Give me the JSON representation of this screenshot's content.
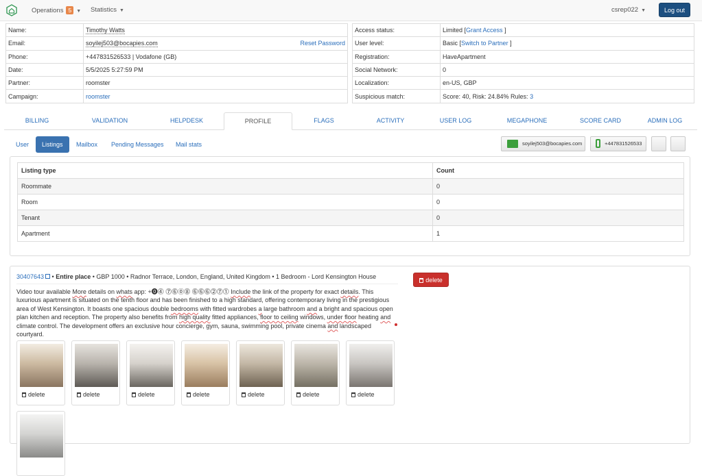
{
  "navbar": {
    "operations_label": "Operations",
    "operations_count": "5",
    "statistics_label": "Statistics",
    "username": "csrep022",
    "logout_label": "Log out"
  },
  "info_left": [
    {
      "label": "Name:",
      "value": "Timothy Watts"
    },
    {
      "label": "Email:",
      "value": "soyilej503@bocapies.com",
      "action": "Reset Password"
    },
    {
      "label": "Phone:",
      "value": "+447831526533 | Vodafone (GB)"
    },
    {
      "label": "Date:",
      "value": "5/5/2025 5:27:59 PM"
    },
    {
      "label": "Partner:",
      "value": "roomster"
    },
    {
      "label": "Campaign:",
      "value": "roomster"
    }
  ],
  "info_right": [
    {
      "label": "Access status:",
      "value": "Limited",
      "bracket_open": " [",
      "link": "Grant Access",
      "bracket_close": " ]"
    },
    {
      "label": "User level:",
      "value": "Basic",
      "bracket_open": " [",
      "link": "Switch to Partner",
      "bracket_close": " ]"
    },
    {
      "label": "Registration:",
      "value": "HaveApartment"
    },
    {
      "label": "Social Network:",
      "value": "0"
    },
    {
      "label": "Localization:",
      "value": "en-US, GBP"
    },
    {
      "label": "Suspicious match:",
      "value": "Score: 40, Risk: 24.84% Rules: ",
      "link": "3"
    }
  ],
  "main_tabs": [
    "BILLING",
    "VALIDATION",
    "HELPDESK",
    "PROFILE",
    "FLAGS",
    "ACTIVITY",
    "USER LOG",
    "MEGAPHONE",
    "SCORE CARD",
    "ADMIN LOG"
  ],
  "active_main_tab": "PROFILE",
  "sub_tabs": [
    "User",
    "Listings",
    "Mailbox",
    "Pending Messages",
    "Mail stats"
  ],
  "active_sub_tab": "Listings",
  "contact_buttons": {
    "email": "soyilej503@bocapies.com",
    "phone": "+447831526533"
  },
  "listing_types": {
    "headers": [
      "Listing type",
      "Count"
    ],
    "rows": [
      {
        "type": "Roommate",
        "count": "0"
      },
      {
        "type": "Room",
        "count": "0"
      },
      {
        "type": "Tenant",
        "count": "0"
      },
      {
        "type": "Apartment",
        "count": "1"
      }
    ]
  },
  "listing": {
    "id": "30407643",
    "sep1": " • ",
    "kind": "Entire place",
    "rest": " • GBP 1000 • Radnor Terrace, London, England, United Kingdom • 1 Bedroom - Lord Kensington House",
    "delete_label": "delete",
    "description": [
      {
        "t": "Video tour available "
      },
      {
        "t": "More",
        "s": true
      },
      {
        "t": " details on "
      },
      {
        "t": "whats",
        "s": true
      },
      {
        "t": " app: +⓿⓸ ⓻⓺⓪⓼ ⓺⓺⓺⓶⓻⓵ "
      },
      {
        "t": "Include",
        "s": true
      },
      {
        "t": " the link of the property for exact "
      },
      {
        "t": "details",
        "s": true
      },
      {
        "t": ". This luxurious apartment is situated on the tenth floor and has been finished to a high standard, offering contemporary living in the prestigious area of West Kensington. It boasts one spacious double "
      },
      {
        "t": "bedrooms",
        "s": true
      },
      {
        "t": " with fitted wardrobes "
      },
      {
        "t": "a",
        "s": true
      },
      {
        "t": " large bathroom "
      },
      {
        "t": "and",
        "s": true
      },
      {
        "t": " a bright and spacious open plan kitchen and reception. The property also benefits from "
      },
      {
        "t": "high quality",
        "s": true
      },
      {
        "t": " fitted appliances, "
      },
      {
        "t": "floor to ceiling",
        "s": true
      },
      {
        "t": " windows, "
      },
      {
        "t": "under floor",
        "s": true
      },
      {
        "t": " heating "
      },
      {
        "t": "and",
        "s": true
      },
      {
        "t": " climate control. The development offers an exclusive hour concierge, gym, sauna, swimming pool, private cinema "
      },
      {
        "t": "and",
        "s": true
      },
      {
        "t": " landscaped courtyard."
      }
    ],
    "photo_delete_label": "delete",
    "photo_count": 8
  }
}
